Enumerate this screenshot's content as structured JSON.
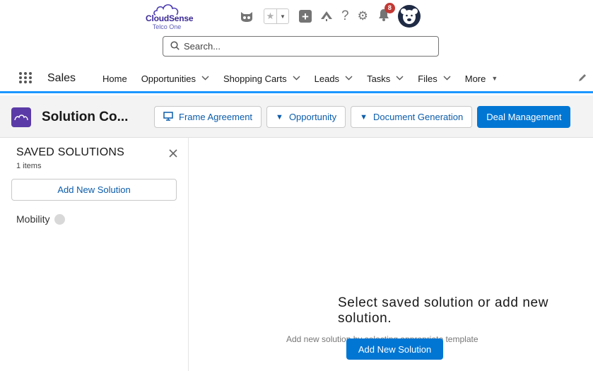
{
  "header": {
    "logo": {
      "brand": "CloudSense",
      "sub": "Telco One"
    },
    "notifications_count": "8",
    "search": {
      "placeholder": "Search..."
    },
    "icons": [
      "cat-icon",
      "star-icon",
      "dropdown-icon",
      "plus-icon",
      "trailhead-icon",
      "help-icon",
      "gear-icon",
      "bell-icon",
      "avatar-icon"
    ]
  },
  "nav": {
    "app_name": "Sales",
    "items": [
      {
        "label": "Home"
      },
      {
        "label": "Opportunities"
      },
      {
        "label": "Shopping Carts"
      },
      {
        "label": "Leads"
      },
      {
        "label": "Tasks"
      },
      {
        "label": "Files"
      },
      {
        "label": "More"
      }
    ]
  },
  "page": {
    "title": "Solution Co...",
    "actions": {
      "frame_agreement": "Frame Agreement",
      "opportunity": "Opportunity",
      "document_generation": "Document Generation",
      "deal_management": "Deal Management"
    }
  },
  "saved_solutions": {
    "title": "SAVED SOLUTIONS",
    "count": "1 items",
    "add_label": "Add New Solution",
    "items": [
      {
        "name": "Mobility"
      }
    ]
  },
  "empty_state": {
    "title": "Select saved solution or add new solution.",
    "subtitle": "Add new solution by selecting appropriate template",
    "button_label": "Add New Solution"
  },
  "colors": {
    "accent": "#0176d3",
    "nav_underline": "#1b96ff",
    "object_icon": "#5a3aa6",
    "notification_badge": "#c23934"
  }
}
